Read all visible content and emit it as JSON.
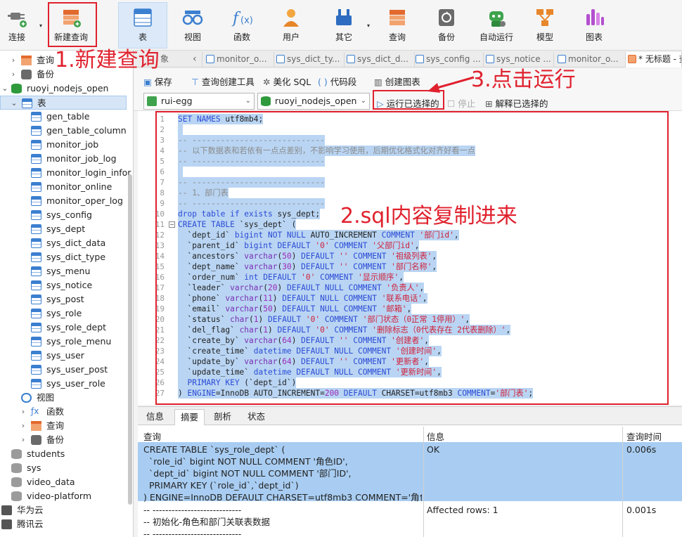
{
  "toolbar": {
    "connect": "连接",
    "new_query": "新建查询",
    "table": "表",
    "view": "视图",
    "function": "函数",
    "user": "用户",
    "other": "其它",
    "query": "查询",
    "backup": "备份",
    "auto_run": "自动运行",
    "model": "模型",
    "chart": "图表"
  },
  "sidebar": {
    "items": [
      {
        "label": "查询",
        "arrow": "›"
      },
      {
        "label": "备份",
        "arrow": "›"
      },
      {
        "label": "ruoyi_nodejs_open",
        "arrow": "⌄"
      },
      {
        "label": "表",
        "arrow": "⌄"
      },
      {
        "label": "gen_table"
      },
      {
        "label": "gen_table_column"
      },
      {
        "label": "monitor_job"
      },
      {
        "label": "monitor_job_log"
      },
      {
        "label": "monitor_login_infor"
      },
      {
        "label": "monitor_online"
      },
      {
        "label": "monitor_oper_log"
      },
      {
        "label": "sys_config"
      },
      {
        "label": "sys_dept"
      },
      {
        "label": "sys_dict_data"
      },
      {
        "label": "sys_dict_type"
      },
      {
        "label": "sys_menu"
      },
      {
        "label": "sys_notice"
      },
      {
        "label": "sys_post"
      },
      {
        "label": "sys_role"
      },
      {
        "label": "sys_role_dept"
      },
      {
        "label": "sys_role_menu"
      },
      {
        "label": "sys_user"
      },
      {
        "label": "sys_user_post"
      },
      {
        "label": "sys_user_role"
      },
      {
        "label": "视图"
      },
      {
        "label": "函数",
        "arrow": "›"
      },
      {
        "label": "查询",
        "arrow": "›"
      },
      {
        "label": "备份",
        "arrow": "›"
      },
      {
        "label": "students"
      },
      {
        "label": "sys"
      },
      {
        "label": "video_data"
      },
      {
        "label": "video-platform"
      },
      {
        "label": "华为云"
      },
      {
        "label": "腾讯云"
      }
    ]
  },
  "tabs": {
    "partial": "象",
    "nav_left": "‹",
    "items": [
      "monitor_o...",
      "sys_dict_ty...",
      "sys_dict_d...",
      "sys_config ...",
      "sys_notice ...",
      "monitor_o..."
    ],
    "active": "* 无标题 - 查"
  },
  "actions": {
    "save": "保存",
    "query_builder": "查询创建工具",
    "beautify": "美化 SQL",
    "snippet": "代码段",
    "create_chart": "创建图表",
    "connection": "rui-egg",
    "database": "ruoyi_nodejs_open",
    "run_selected": "运行已选择的",
    "stop": "停止",
    "explain": "解释已选择的"
  },
  "annotations": {
    "step1": "1.新建查询",
    "step2": "2.sql内容复制进来",
    "step3": "3.点击运行"
  },
  "code": {
    "lines": [
      [
        [
          "kw",
          "SET NAMES "
        ],
        [
          "plain",
          "utf8mb4;"
        ]
      ],
      [
        [
          "plain",
          " "
        ]
      ],
      [
        [
          "cm",
          "-- ----------------------------"
        ]
      ],
      [
        [
          "cm",
          "-- 以下数据表和若依有一点点差别，不影响学习使用，后期优化格式化对齐好看一点"
        ]
      ],
      [
        [
          "cm",
          "-- ----------------------------"
        ]
      ],
      [
        [
          "plain",
          " "
        ]
      ],
      [
        [
          "cm",
          "-- ----------------------------"
        ]
      ],
      [
        [
          "cm",
          "-- 1、部门表"
        ]
      ],
      [
        [
          "cm",
          "-- ----------------------------"
        ]
      ],
      [
        [
          "kw",
          "drop table if exists "
        ],
        [
          "plain",
          "sys_dept;"
        ]
      ],
      [
        [
          "kw",
          "CREATE TABLE "
        ],
        [
          "plain",
          "`sys_dept` ("
        ]
      ],
      [
        [
          "plain",
          "  `dept_id` "
        ],
        [
          "kw",
          "bigint NOT NULL "
        ],
        [
          "plain",
          "AUTO_INCREMENT "
        ],
        [
          "kw",
          "COMMENT "
        ],
        [
          "str",
          "'部门id'"
        ],
        [
          "plain",
          ","
        ]
      ],
      [
        [
          "plain",
          "  `parent_id` "
        ],
        [
          "kw",
          "bigint DEFAULT "
        ],
        [
          "str",
          "'0' "
        ],
        [
          "kw",
          "COMMENT "
        ],
        [
          "str",
          "'父部门id'"
        ],
        [
          "plain",
          ","
        ]
      ],
      [
        [
          "plain",
          "  `ancestors` "
        ],
        [
          "fn",
          "varchar"
        ],
        [
          "plain",
          "("
        ],
        [
          "num",
          "50"
        ],
        [
          "plain",
          ") "
        ],
        [
          "kw",
          "DEFAULT "
        ],
        [
          "str",
          "'' "
        ],
        [
          "kw",
          "COMMENT "
        ],
        [
          "str",
          "'祖级列表'"
        ],
        [
          "plain",
          ","
        ]
      ],
      [
        [
          "plain",
          "  `dept_name` "
        ],
        [
          "fn",
          "varchar"
        ],
        [
          "plain",
          "("
        ],
        [
          "num",
          "30"
        ],
        [
          "plain",
          ") "
        ],
        [
          "kw",
          "DEFAULT "
        ],
        [
          "str",
          "'' "
        ],
        [
          "kw",
          "COMMENT "
        ],
        [
          "str",
          "'部门名称'"
        ],
        [
          "plain",
          ","
        ]
      ],
      [
        [
          "plain",
          "  `order_num` "
        ],
        [
          "kw",
          "int DEFAULT "
        ],
        [
          "str",
          "'0' "
        ],
        [
          "kw",
          "COMMENT "
        ],
        [
          "str",
          "'显示顺序'"
        ],
        [
          "plain",
          ","
        ]
      ],
      [
        [
          "plain",
          "  `leader` "
        ],
        [
          "fn",
          "varchar"
        ],
        [
          "plain",
          "("
        ],
        [
          "num",
          "20"
        ],
        [
          "plain",
          ") "
        ],
        [
          "kw",
          "DEFAULT NULL COMMENT "
        ],
        [
          "str",
          "'负责人'"
        ],
        [
          "plain",
          ","
        ]
      ],
      [
        [
          "plain",
          "  `phone` "
        ],
        [
          "fn",
          "varchar"
        ],
        [
          "plain",
          "("
        ],
        [
          "num",
          "11"
        ],
        [
          "plain",
          ") "
        ],
        [
          "kw",
          "DEFAULT NULL COMMENT "
        ],
        [
          "str",
          "'联系电话'"
        ],
        [
          "plain",
          ","
        ]
      ],
      [
        [
          "plain",
          "  `email` "
        ],
        [
          "fn",
          "varchar"
        ],
        [
          "plain",
          "("
        ],
        [
          "num",
          "50"
        ],
        [
          "plain",
          ") "
        ],
        [
          "kw",
          "DEFAULT NULL COMMENT "
        ],
        [
          "str",
          "'邮箱'"
        ],
        [
          "plain",
          ","
        ]
      ],
      [
        [
          "plain",
          "  `status` "
        ],
        [
          "fn",
          "char"
        ],
        [
          "plain",
          "("
        ],
        [
          "num",
          "1"
        ],
        [
          "plain",
          ") "
        ],
        [
          "kw",
          "DEFAULT "
        ],
        [
          "str",
          "'0' "
        ],
        [
          "kw",
          "COMMENT "
        ],
        [
          "str",
          "'部门状态（0正常 1停用）'"
        ],
        [
          "plain",
          ","
        ]
      ],
      [
        [
          "plain",
          "  `del_flag` "
        ],
        [
          "fn",
          "char"
        ],
        [
          "plain",
          "("
        ],
        [
          "num",
          "1"
        ],
        [
          "plain",
          ") "
        ],
        [
          "kw",
          "DEFAULT "
        ],
        [
          "str",
          "'0' "
        ],
        [
          "kw",
          "COMMENT "
        ],
        [
          "str",
          "'删除标志（0代表存在 2代表删除）'"
        ],
        [
          "plain",
          ","
        ]
      ],
      [
        [
          "plain",
          "  `create_by` "
        ],
        [
          "fn",
          "varchar"
        ],
        [
          "plain",
          "("
        ],
        [
          "num",
          "64"
        ],
        [
          "plain",
          ") "
        ],
        [
          "kw",
          "DEFAULT "
        ],
        [
          "str",
          "'' "
        ],
        [
          "kw",
          "COMMENT "
        ],
        [
          "str",
          "'创建者'"
        ],
        [
          "plain",
          ","
        ]
      ],
      [
        [
          "plain",
          "  `create_time` "
        ],
        [
          "kw",
          "datetime DEFAULT NULL COMMENT "
        ],
        [
          "str",
          "'创建时间'"
        ],
        [
          "plain",
          ","
        ]
      ],
      [
        [
          "plain",
          "  `update_by` "
        ],
        [
          "fn",
          "varchar"
        ],
        [
          "plain",
          "("
        ],
        [
          "num",
          "64"
        ],
        [
          "plain",
          ") "
        ],
        [
          "kw",
          "DEFAULT "
        ],
        [
          "str",
          "'' "
        ],
        [
          "kw",
          "COMMENT "
        ],
        [
          "str",
          "'更新者'"
        ],
        [
          "plain",
          ","
        ]
      ],
      [
        [
          "plain",
          "  `update_time` "
        ],
        [
          "kw",
          "datetime DEFAULT NULL COMMENT "
        ],
        [
          "str",
          "'更新时间'"
        ],
        [
          "plain",
          ","
        ]
      ],
      [
        [
          "kw",
          "  PRIMARY KEY "
        ],
        [
          "plain",
          "(`dept_id`)"
        ]
      ],
      [
        [
          "plain",
          ") "
        ],
        [
          "kw",
          "ENGINE"
        ],
        [
          "plain",
          "=InnoDB AUTO_INCREMENT="
        ],
        [
          "num",
          "200 "
        ],
        [
          "kw",
          "DEFAULT "
        ],
        [
          "plain",
          "CHARSET=utf8mb3 "
        ],
        [
          "kw",
          "COMMENT"
        ],
        [
          "plain",
          "="
        ],
        [
          "str",
          "'部门表'"
        ],
        [
          "plain",
          ";"
        ]
      ]
    ]
  },
  "result": {
    "tabs": [
      "信息",
      "摘要",
      "剖析",
      "状态"
    ],
    "active_tab": "摘要",
    "headers": {
      "query": "查询",
      "info": "信息",
      "time": "查询时间"
    },
    "rows": [
      {
        "query": "CREATE TABLE `sys_role_dept` (\n  `role_id` bigint NOT NULL COMMENT '角色ID',\n  `dept_id` bigint NOT NULL COMMENT '部门ID',\n  PRIMARY KEY (`role_id`,`dept_id`)\n) ENGINE=InnoDB DEFAULT CHARSET=utf8mb3 COMMENT='角色和",
        "info": "OK",
        "time": "0.006s"
      },
      {
        "query": "-- ----------------------------\n-- 初始化-角色和部门关联表数据\n-- ----------------------------",
        "info": "Affected rows: 1",
        "time": "0.001s"
      }
    ]
  }
}
